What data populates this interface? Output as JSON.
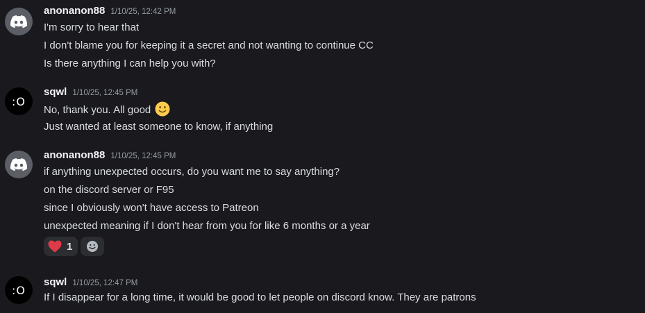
{
  "messages": [
    {
      "author": "anonanon88",
      "avatar_icon": "discord-logo-icon",
      "timestamp": "1/10/25, 12:42 PM",
      "lines": [
        "I'm sorry to hear that",
        "I don't blame you for keeping it a secret and not wanting to continue CC",
        "Is there anything I can help you with?"
      ]
    },
    {
      "author": "sqwl",
      "avatar_text": ":O",
      "timestamp": "1/10/25, 12:45 PM",
      "lines": [
        "No, thank you. All good",
        "Just wanted at least someone to know, if anything"
      ],
      "emoji": "slightly-smiling-face-icon"
    },
    {
      "author": "anonanon88",
      "avatar_icon": "discord-logo-icon",
      "timestamp": "1/10/25, 12:45 PM",
      "lines": [
        "if anything unexpected occurs, do you want me to say anything?",
        "on the discord server or F95",
        "since I obviously won't have access to Patreon",
        "unexpected meaning if I don't hear from you for like 6 months or a year"
      ],
      "reactions": [
        {
          "icon": "red-heart-icon",
          "count": "1"
        }
      ]
    },
    {
      "author": "sqwl",
      "avatar_text": ":O",
      "timestamp": "1/10/25, 12:47 PM",
      "lines": [
        "If I disappear for a long time, it would be good to let people on discord know. They are patrons"
      ]
    }
  ],
  "colors": {
    "background": "#1a1a1e",
    "text": "#dbdee1",
    "author": "#f2f3f5",
    "timestamp": "#949ba4",
    "reaction_bg": "#2b2d31",
    "heart": "#e0394a",
    "emoji": "#ffcc4d"
  }
}
